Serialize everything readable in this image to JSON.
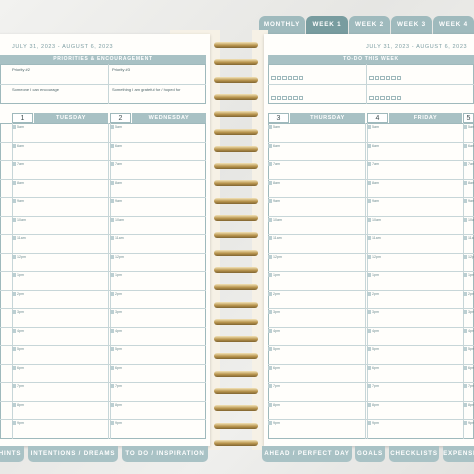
{
  "top_tabs": [
    {
      "label": "MONTHLY"
    },
    {
      "label": "WEEK 1",
      "active": true
    },
    {
      "label": "WEEK 2"
    },
    {
      "label": "WEEK 3"
    },
    {
      "label": "WEEK 4"
    }
  ],
  "left_page": {
    "date_range": "JULY 31, 2023 - AUGUST 6, 2023",
    "priorities_title": "PRIORITIES & ENCOURAGEMENT",
    "priority_2": "Priority #2",
    "priority_3": "Priority #3",
    "encourage": "Someone I can encourage",
    "grateful": "Something I am grateful for / hoped for",
    "day1_num": "1",
    "day1_name": "TUESDAY",
    "day2_num": "2",
    "day2_name": "WEDNESDAY"
  },
  "right_page": {
    "date_range": "JULY 31, 2023 - AUGUST 6, 2023",
    "todo_title": "TO-DO THIS WEEK",
    "day3_num": "3",
    "day3_name": "THURSDAY",
    "day4_num": "4",
    "day4_name": "FRIDAY",
    "day5_num": "5"
  },
  "hours": [
    "5am",
    "6am",
    "7am",
    "8am",
    "9am",
    "10am",
    "11am",
    "12pm",
    "1pm",
    "2pm",
    "3pm",
    "4pm",
    "5pm",
    "6pm",
    "7pm",
    "8pm",
    "9pm"
  ],
  "bottom_tabs": [
    {
      "label": "HINTS"
    },
    {
      "label": "INTENTIONS / DREAMS"
    },
    {
      "label": "TO DO / INSPIRATION"
    },
    {
      "label": "AHEAD / PERFECT DAY"
    },
    {
      "label": "GOALS"
    },
    {
      "label": "CHECKLISTS"
    },
    {
      "label": "EXPENSES"
    }
  ],
  "colors": {
    "accent": "#a8c1c4",
    "active_tab": "#789c9f",
    "tab": "#9fbabd",
    "coil": "#b9954f"
  }
}
